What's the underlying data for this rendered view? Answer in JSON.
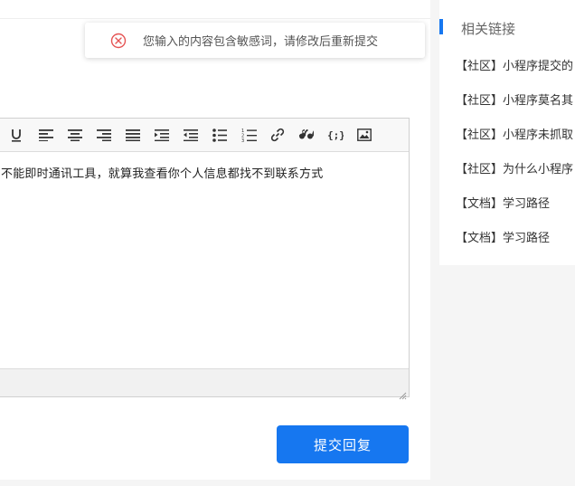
{
  "toast": {
    "icon": "error-circle-icon",
    "message": "您输入的内容包含敏感词，请修改后重新提交",
    "color": "#e55353"
  },
  "editor": {
    "toolbar": [
      {
        "name": "underline-icon"
      },
      {
        "name": "align-left-icon"
      },
      {
        "name": "align-center-icon"
      },
      {
        "name": "align-right-icon"
      },
      {
        "name": "align-justify-icon"
      },
      {
        "name": "indent-icon"
      },
      {
        "name": "outdent-icon"
      },
      {
        "name": "bullet-list-icon"
      },
      {
        "name": "numbered-list-icon"
      },
      {
        "name": "link-icon"
      },
      {
        "name": "quote-icon"
      },
      {
        "name": "code-block-icon"
      },
      {
        "name": "image-icon"
      }
    ],
    "content": "不能即时通讯工具，就算我查看你个人信息都找不到联系方式"
  },
  "submit_label": "提交回复",
  "accent_color": "#1677f0",
  "sidebar": {
    "title": "相关链接",
    "links": [
      {
        "label": "【社区】小程序提交的"
      },
      {
        "label": "【社区】小程序莫名其"
      },
      {
        "label": "【社区】小程序未抓取"
      },
      {
        "label": "【社区】为什么小程序"
      },
      {
        "label": "【文档】学习路径"
      },
      {
        "label": "【文档】学习路径"
      }
    ]
  }
}
